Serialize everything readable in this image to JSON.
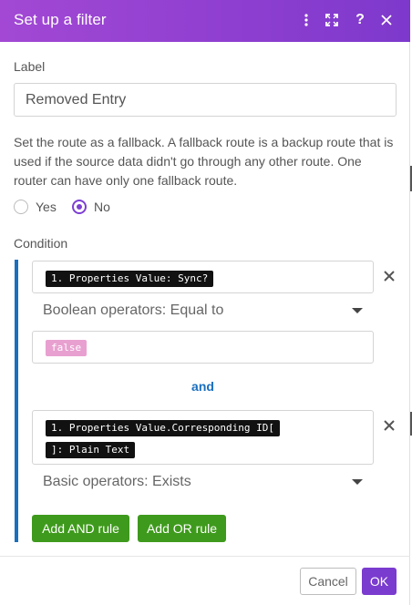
{
  "header": {
    "title": "Set up a filter",
    "icons": [
      "more-vertical-icon",
      "fullscreen-icon",
      "help-icon",
      "close-icon"
    ]
  },
  "label_field": {
    "label": "Label",
    "value": "Removed Entry"
  },
  "fallback": {
    "help_text": "Set the route as a fallback. A fallback route is a backup route that is used if the source data didn't go through any other route. One router can have only one fallback route.",
    "options": [
      {
        "label": "Yes",
        "checked": false
      },
      {
        "label": "No",
        "checked": true
      }
    ]
  },
  "condition": {
    "label": "Condition",
    "rules": [
      {
        "operand_a": [
          "1. Properties Value: Sync?"
        ],
        "operator": "Boolean operators: Equal to",
        "operand_b": "false"
      },
      {
        "operand_a": [
          "1. Properties Value.Corresponding ID[",
          "]: Plain Text"
        ],
        "operator": "Basic operators: Exists"
      }
    ],
    "joiner": "and",
    "add_and_label": "Add AND rule",
    "add_or_label": "Add OR rule"
  },
  "footer": {
    "cancel_label": "Cancel",
    "ok_label": "OK"
  },
  "colors": {
    "header_gradient_start": "#a248d4",
    "header_gradient_end": "#7d39cc",
    "accent_purple": "#7a3bcf",
    "condition_blue": "#1a6fbf",
    "button_green": "#3e9a1c",
    "pill_dark": "#111111",
    "pill_pink": "#e8a0d0"
  }
}
